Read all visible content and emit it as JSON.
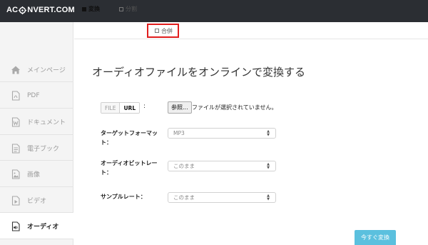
{
  "brand": {
    "logo_text_left": "AC",
    "logo_text_right": "NVERT.COM"
  },
  "sidebar": {
    "items": [
      {
        "label": "メインページ",
        "icon": "home-icon"
      },
      {
        "label": "PDF",
        "icon": "pdf-file-icon"
      },
      {
        "label": "ドキュメント",
        "icon": "word-document-icon"
      },
      {
        "label": "電子ブック",
        "icon": "ebook-icon"
      },
      {
        "label": "画像",
        "icon": "image-icon"
      },
      {
        "label": "ビデオ",
        "icon": "video-icon"
      },
      {
        "label": "オーディオ",
        "icon": "audio-icon",
        "active": true
      }
    ]
  },
  "tabs": [
    {
      "label": "変換",
      "active": true
    },
    {
      "label": "分割",
      "active": false
    },
    {
      "label": "合併",
      "active": false,
      "highlighted": true
    }
  ],
  "main": {
    "title": "オーディオファイルをオンラインで変換する",
    "source_toggle": {
      "file_label": "FILE",
      "url_label": "URL",
      "selected": "URL",
      "colon": ":"
    },
    "browse_label": "参照...",
    "no_file_text": "ファイルが選択されていません。",
    "fields": [
      {
        "label_line1": "ターゲットフォーマッ",
        "label_line2": "ト：",
        "value": "MP3"
      },
      {
        "label_line1": "オーディオビットレー",
        "label_line2": "ト：",
        "value": "このまま"
      },
      {
        "label_line1": "サンプルレート：",
        "label_line2": "",
        "value": "このまま"
      }
    ],
    "convert_label": "今すぐ変換"
  },
  "colors": {
    "topbar": "#2b2e33",
    "accent_button": "#5bc0de",
    "highlight_box": "#e01e1e",
    "sidebar_bg": "#f4f4f4"
  }
}
